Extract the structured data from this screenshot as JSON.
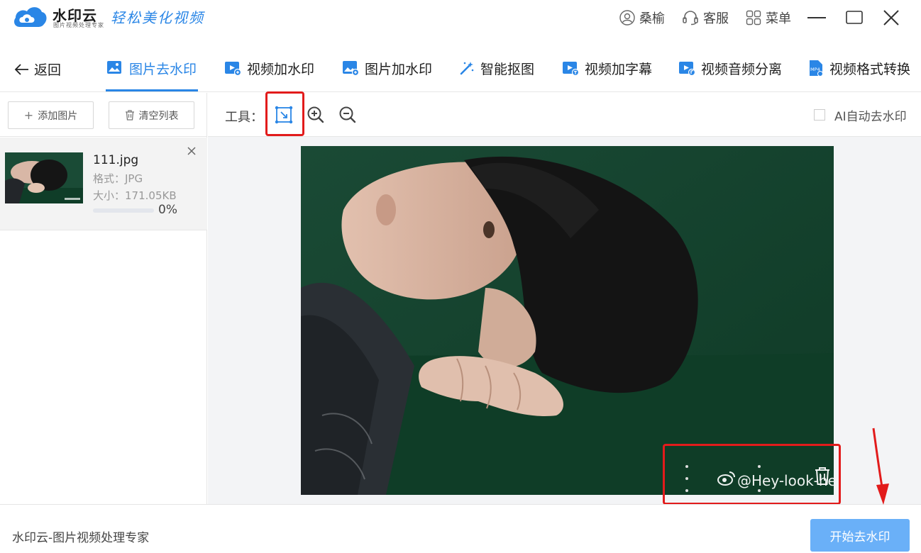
{
  "titlebar": {
    "brand_name": "水印云",
    "brand_sub": "图片视频处理专家",
    "slogan": "轻松美化视频",
    "user_label": "桑榆",
    "service_label": "客服",
    "menu_label": "菜单"
  },
  "nav": {
    "back_label": "返回",
    "tabs": [
      {
        "label": "图片去水印",
        "icon": "image-icon",
        "active": true
      },
      {
        "label": "视频加水印",
        "icon": "video-add-icon"
      },
      {
        "label": "图片加水印",
        "icon": "image-add-icon"
      },
      {
        "label": "智能抠图",
        "icon": "magic-wand-icon"
      },
      {
        "label": "视频加字幕",
        "icon": "video-subtitle-icon"
      },
      {
        "label": "视频音频分离",
        "icon": "video-audio-icon"
      },
      {
        "label": "视频格式转换",
        "icon": "mp4-file-icon",
        "icon_text": "MP4"
      }
    ]
  },
  "left_panel": {
    "add_label": "添加图片",
    "clear_label": "清空列表",
    "file": {
      "name": "111.jpg",
      "format": "格式：JPG",
      "size": "大小：171.05KB",
      "progress": 0,
      "progress_label": "0%"
    }
  },
  "tools": {
    "label": "工具：",
    "icons": [
      "select-region-icon",
      "zoom-in-icon",
      "zoom-out-icon"
    ],
    "ai_label": "AI自动去水印",
    "ai_checked": false
  },
  "canvas": {
    "watermark_text": "@Hey-look-he"
  },
  "footer": {
    "app_text": "水印云-图片视频处理专家",
    "start_label": "开始去水印"
  },
  "colors": {
    "accent": "#2a86e6",
    "start_button": "#6ab0f8",
    "highlight": "#e21b1b",
    "photo_bg": "#164632"
  }
}
